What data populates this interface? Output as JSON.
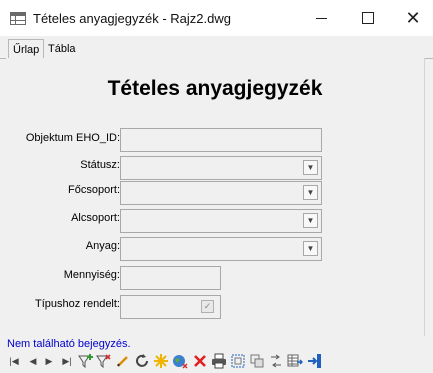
{
  "window": {
    "title": "Tételes anyagjegyzék - Rajz2.dwg",
    "min_glyph": "—",
    "max_glyph": "☐",
    "close_glyph": "✕"
  },
  "tabs": [
    {
      "label": "Űrlap",
      "active": true
    },
    {
      "label": "Tábla",
      "active": false
    }
  ],
  "form": {
    "title": "Tételes anyagjegyzék",
    "fields": {
      "objektum": {
        "label": "Objektum EHO_ID:",
        "value": ""
      },
      "statusz": {
        "label": "Státusz:",
        "value": ""
      },
      "focsoport": {
        "label": "Főcsoport:",
        "value": ""
      },
      "alcsoport": {
        "label": "Alcsoport:",
        "value": ""
      },
      "anyag": {
        "label": "Anyag:",
        "value": ""
      },
      "mennyiseg": {
        "label": "Mennyiség:",
        "value": ""
      },
      "tipushoz": {
        "label": "Típushoz rendelt:",
        "checked": false
      }
    },
    "dropdown_glyph": "▼"
  },
  "status_text": "Nem található bejegyzés.",
  "toolbar": {
    "icons": [
      "first-record-icon",
      "prev-record-icon",
      "next-record-icon",
      "last-record-icon",
      "add-filter-icon",
      "remove-filter-icon",
      "edit-pencil-icon",
      "refresh-icon",
      "highlight-star-icon",
      "globe-icon",
      "delete-x-icon",
      "print-icon",
      "select-objects-icon",
      "copy-objects-icon",
      "move-objects-icon",
      "table-export-icon",
      "exit-icon"
    ]
  },
  "colors": {
    "status_text": "#0000cc",
    "filter_green": "#2e9b2e",
    "filter_red": "#d03030",
    "delete_red": "#e02020",
    "star_yellow": "#f0b400",
    "accent_blue": "#2060c0"
  }
}
